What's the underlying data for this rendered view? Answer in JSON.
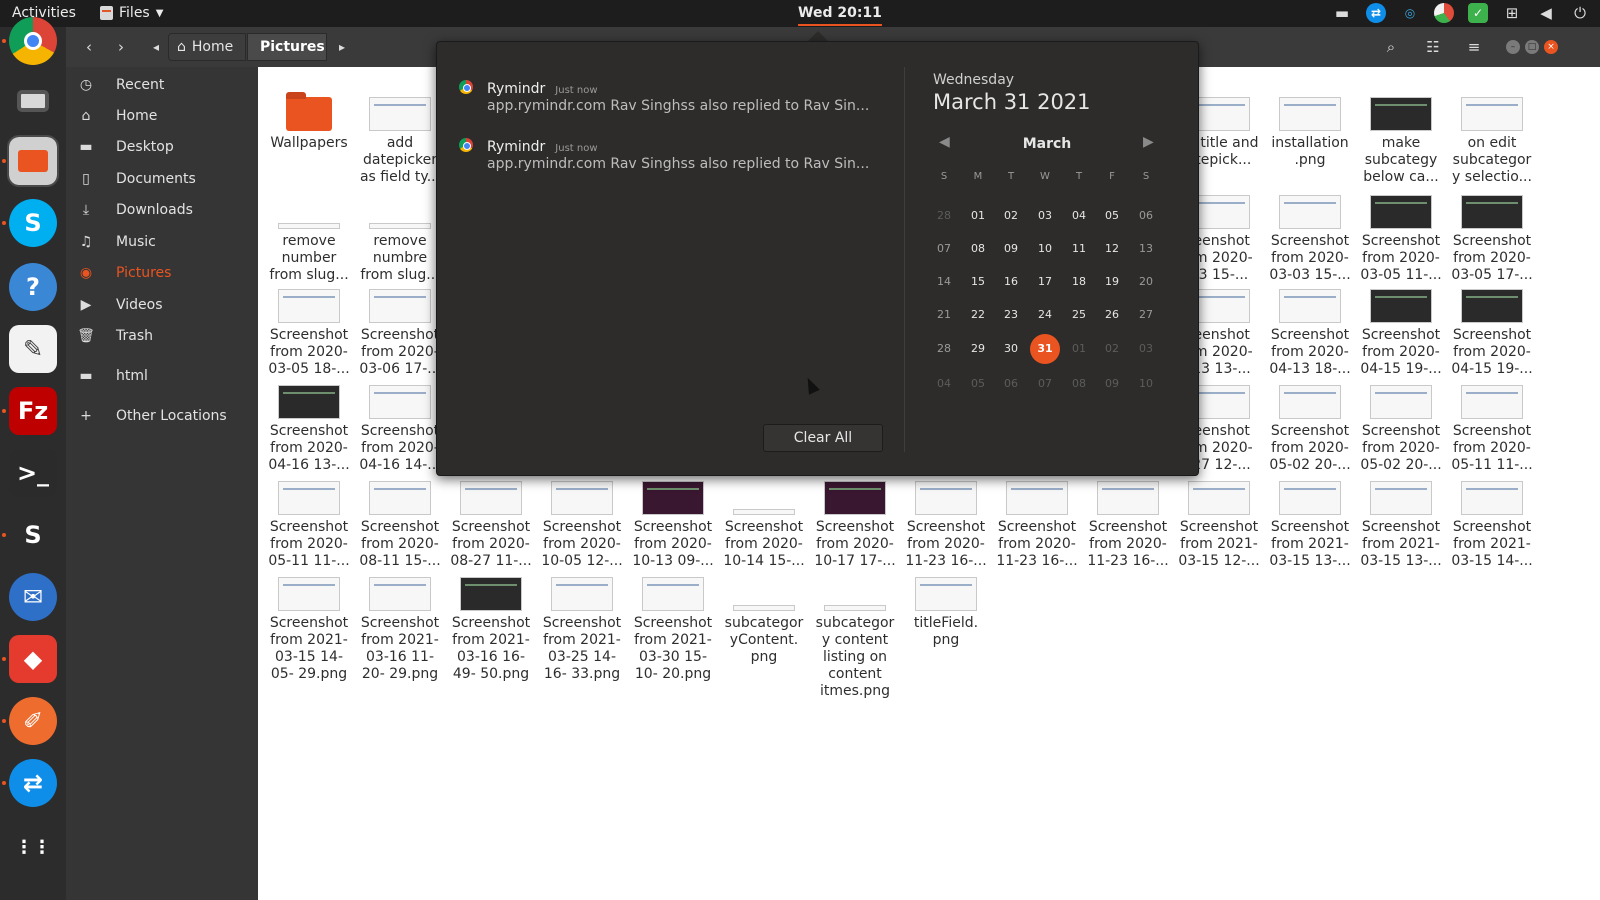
{
  "topbar": {
    "activities": "Activities",
    "app_menu": "Files",
    "clock": "Wed 20:11",
    "tray": [
      {
        "icon": "camera-icon"
      },
      {
        "icon": "teamviewer-icon",
        "color": "#0e8ee9"
      },
      {
        "icon": "wifi-signal-icon",
        "color": "#3aa6e0"
      },
      {
        "icon": "pie-chart-icon",
        "color": "#e04b3a"
      },
      {
        "icon": "check-icon",
        "color": "#3db14b"
      },
      {
        "icon": "network-icon"
      },
      {
        "icon": "volume-icon"
      },
      {
        "icon": "power-icon"
      }
    ]
  },
  "dock": [
    {
      "name": "chrome-icon",
      "color": "#4285f4"
    },
    {
      "name": "camera-app-icon",
      "color": "#8a8a8a"
    },
    {
      "name": "files-icon",
      "color": "#c0c0c0",
      "active": true
    },
    {
      "name": "skype-icon",
      "color": "#00aff0",
      "glyph": "S"
    },
    {
      "name": "help-icon",
      "color": "#3a87d6",
      "glyph": "?"
    },
    {
      "name": "text-editor-icon",
      "color": "#f2f2f2"
    },
    {
      "name": "filezilla-icon",
      "color": "#bf0000",
      "glyph": "Fz"
    },
    {
      "name": "terminal-icon",
      "color": "#2b2b2b",
      "glyph": ">_"
    },
    {
      "name": "sublime-icon",
      "color": "#2c2c2c",
      "glyph": "S"
    },
    {
      "name": "thunderbird-icon",
      "color": "#2e6fc7"
    },
    {
      "name": "anydesk-icon",
      "color": "#e53b2f",
      "glyph": "◆"
    },
    {
      "name": "postman-icon",
      "color": "#ef6c2f"
    },
    {
      "name": "teamviewer-dock-icon",
      "color": "#0e8ee9"
    },
    {
      "name": "app-grid-icon",
      "color": "#2c2c2c",
      "glyph": "⋮⋮"
    }
  ],
  "headerbar": {
    "crumb_home": "Home",
    "crumb_current": "Pictures"
  },
  "sidebar": {
    "items": [
      {
        "label": "Recent",
        "icon": "clock-icon"
      },
      {
        "label": "Home",
        "icon": "home-icon"
      },
      {
        "label": "Desktop",
        "icon": "folder-icon"
      },
      {
        "label": "Documents",
        "icon": "document-icon"
      },
      {
        "label": "Downloads",
        "icon": "download-icon"
      },
      {
        "label": "Music",
        "icon": "music-icon"
      },
      {
        "label": "Pictures",
        "icon": "camera-icon",
        "active": true
      },
      {
        "label": "Videos",
        "icon": "video-icon"
      },
      {
        "label": "Trash",
        "icon": "trash-icon"
      },
      {
        "label": "html",
        "icon": "folder-icon"
      },
      {
        "label": "Other Locations",
        "icon": "plus-icon"
      }
    ]
  },
  "files": [
    {
      "name": "Wallpapers",
      "type": "folder"
    },
    {
      "name": "add datepicker as field ty...",
      "type": "light"
    },
    {
      "name": "ile title and atepick...",
      "type": "light"
    },
    {
      "name": "installation .png",
      "type": "light"
    },
    {
      "name": "make subcategy below ca...",
      "type": "dark"
    },
    {
      "name": "on edit subcategor y selectio...",
      "type": "light"
    },
    {
      "name": "remove number from slug...",
      "type": "line"
    },
    {
      "name": "remove numbre from slug...",
      "type": "line"
    },
    {
      "name": "reenshot om 2020- 03 15-...",
      "type": "light"
    },
    {
      "name": "Screenshot from 2020- 03-03 15-...",
      "type": "light"
    },
    {
      "name": "Screenshot from 2020- 03-05 11-...",
      "type": "dark"
    },
    {
      "name": "Screenshot from 2020- 03-05 17-...",
      "type": "dark"
    },
    {
      "name": "Screenshot from 2020- 03-05 18-...",
      "type": "light"
    },
    {
      "name": "Screenshot from 2020- 03-06 17-...",
      "type": "light"
    },
    {
      "name": "reenshot om 2020- -13 13-...",
      "type": "light"
    },
    {
      "name": "Screenshot from 2020- 04-13 18-...",
      "type": "light"
    },
    {
      "name": "Screenshot from 2020- 04-15 19-...",
      "type": "dark"
    },
    {
      "name": "Screenshot from 2020- 04-15 19-...",
      "type": "dark"
    },
    {
      "name": "Screenshot from 2020- 04-16 13-...",
      "type": "dark"
    },
    {
      "name": "Screenshot from 2020- 04-16 14-...",
      "type": "light"
    },
    {
      "name": "reenshot om 2020- -27 12-...",
      "type": "light"
    },
    {
      "name": "Screenshot from 2020- 05-02 20-...",
      "type": "light"
    },
    {
      "name": "Screenshot from 2020- 05-02 20-...",
      "type": "light"
    },
    {
      "name": "Screenshot from 2020- 05-11 11-...",
      "type": "light"
    },
    {
      "name": "Screenshot from 2020- 05-11 11-...",
      "type": "light"
    },
    {
      "name": "Screenshot from 2020- 08-11 15-...",
      "type": "light"
    },
    {
      "name": "Screenshot from 2020- 08-27 11-...",
      "type": "light"
    },
    {
      "name": "Screenshot from 2020- 10-05 12-...",
      "type": "light"
    },
    {
      "name": "Screenshot from 2020- 10-13 09-...",
      "type": "purple"
    },
    {
      "name": "Screenshot from 2020- 10-14 15-...",
      "type": "line"
    },
    {
      "name": "Screenshot from 2020- 10-17 17-...",
      "type": "purple"
    },
    {
      "name": "Screenshot from 2020- 11-23 16-...",
      "type": "light"
    },
    {
      "name": "Screenshot from 2020- 11-23 16-...",
      "type": "light"
    },
    {
      "name": "Screenshot from 2020- 11-23 16-...",
      "type": "light"
    },
    {
      "name": "Screenshot from 2021- 03-15 12-...",
      "type": "light"
    },
    {
      "name": "Screenshot from 2021- 03-15 13-...",
      "type": "light"
    },
    {
      "name": "Screenshot from 2021- 03-15 13-...",
      "type": "light"
    },
    {
      "name": "Screenshot from 2021- 03-15 14-...",
      "type": "light"
    },
    {
      "name": "Screenshot from 2021- 03-15 14-05- 29.png",
      "type": "light"
    },
    {
      "name": "Screenshot from 2021- 03-16 11-20- 29.png",
      "type": "light"
    },
    {
      "name": "Screenshot from 2021- 03-16 16-49- 50.png",
      "type": "dark"
    },
    {
      "name": "Screenshot from 2021- 03-25 14-16- 33.png",
      "type": "light"
    },
    {
      "name": "Screenshot from 2021- 03-30 15-10- 20.png",
      "type": "light"
    },
    {
      "name": "subcategor yContent. png",
      "type": "line"
    },
    {
      "name": "subcategor y content listing on content itmes.png",
      "type": "line"
    },
    {
      "name": "titleField. png",
      "type": "light"
    }
  ],
  "notifications": [
    {
      "app": "Rymindr",
      "time": "Just now",
      "body": "app.rymindr.com  Rav Singhss also replied to Rav Sin..."
    },
    {
      "app": "Rymindr",
      "time": "Just now",
      "body": "app.rymindr.com  Rav Singhss also replied to Rav Sin..."
    }
  ],
  "calendar": {
    "weekday": "Wednesday",
    "date": "March 31 2021",
    "month": "March",
    "headers": [
      "S",
      "M",
      "T",
      "W",
      "T",
      "F",
      "S"
    ],
    "weeks": [
      [
        "28",
        "01",
        "02",
        "03",
        "04",
        "05",
        "06"
      ],
      [
        "07",
        "08",
        "09",
        "10",
        "11",
        "12",
        "13"
      ],
      [
        "14",
        "15",
        "16",
        "17",
        "18",
        "19",
        "20"
      ],
      [
        "21",
        "22",
        "23",
        "24",
        "25",
        "26",
        "27"
      ],
      [
        "28",
        "29",
        "30",
        "31",
        "01",
        "02",
        "03"
      ],
      [
        "04",
        "05",
        "06",
        "07",
        "08",
        "09",
        "10"
      ]
    ],
    "today": "31",
    "accent": "#e95420"
  },
  "clear_all": "Clear All"
}
